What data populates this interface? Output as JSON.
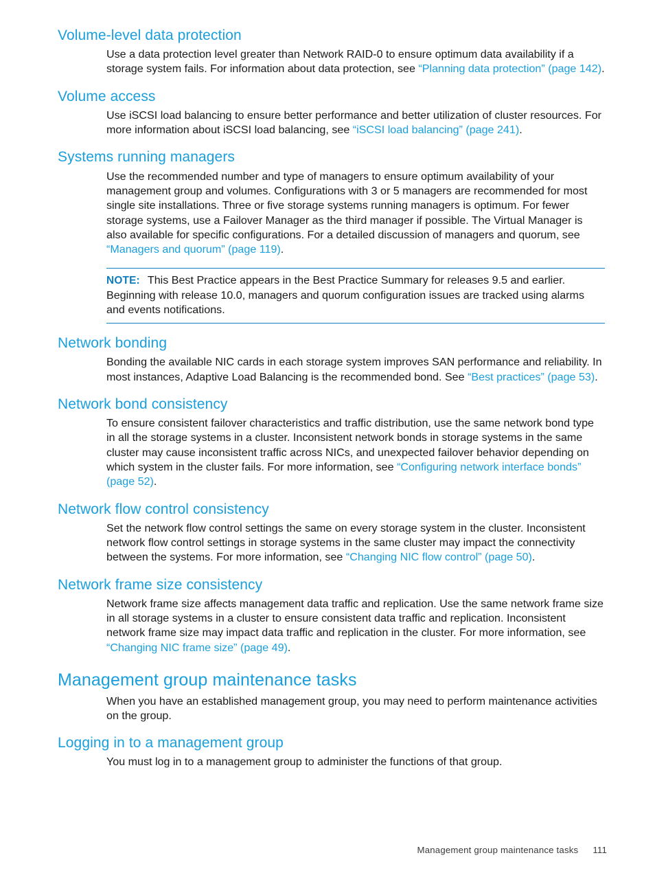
{
  "theme": {
    "heading_color": "#1a9fdc",
    "link_color": "#1a9fdc",
    "note_rule_color": "#0f80bd",
    "body_color": "#1a1a1a",
    "page_background": "#ffffff"
  },
  "sections": [
    {
      "id": "volume-level-data-protection",
      "level": "h2",
      "heading": "Volume-level data protection",
      "paragraphs": [
        {
          "runs": [
            {
              "type": "text",
              "text": "Use a data protection level greater than Network RAID-0 to ensure optimum data availability if a storage system fails. For information about data protection, see "
            },
            {
              "type": "link",
              "text": "“Planning data protection” (page 142)"
            },
            {
              "type": "text",
              "text": "."
            }
          ]
        }
      ]
    },
    {
      "id": "volume-access",
      "level": "h2",
      "heading": "Volume access",
      "paragraphs": [
        {
          "runs": [
            {
              "type": "text",
              "text": "Use iSCSI load balancing to ensure better performance and better utilization of cluster resources. For more information about iSCSI load balancing, see "
            },
            {
              "type": "link",
              "text": "“iSCSI load balancing” (page 241)"
            },
            {
              "type": "text",
              "text": "."
            }
          ]
        }
      ]
    },
    {
      "id": "systems-running-managers",
      "level": "h2",
      "heading": "Systems running managers",
      "paragraphs": [
        {
          "runs": [
            {
              "type": "text",
              "text": "Use the recommended number and type of managers to ensure optimum availability of your management group and volumes. Configurations with 3 or 5 managers are recommended for most single site installations. Three or five storage systems running managers is optimum. For fewer storage systems, use a Failover Manager as the third manager if possible. The Virtual Manager is also available for specific configurations. For a detailed discussion of managers and quorum, see "
            },
            {
              "type": "link",
              "text": "“Managers and quorum” (page 119)"
            },
            {
              "type": "text",
              "text": "."
            }
          ]
        }
      ],
      "note": {
        "label": "NOTE:",
        "text": "This Best Practice appears in the Best Practice Summary for releases 9.5 and earlier. Beginning with release 10.0, managers and quorum configuration issues are tracked using alarms and events notifications."
      }
    },
    {
      "id": "network-bonding",
      "level": "h2",
      "heading": "Network bonding",
      "paragraphs": [
        {
          "runs": [
            {
              "type": "text",
              "text": "Bonding the available NIC cards in each storage system improves SAN performance and reliability. In most instances, Adaptive Load Balancing is the recommended bond. See "
            },
            {
              "type": "link",
              "text": "“Best practices” (page 53)"
            },
            {
              "type": "text",
              "text": "."
            }
          ]
        }
      ]
    },
    {
      "id": "network-bond-consistency",
      "level": "h2",
      "heading": "Network bond consistency",
      "paragraphs": [
        {
          "runs": [
            {
              "type": "text",
              "text": "To ensure consistent failover characteristics and traffic distribution, use the same network bond type in all the storage systems in a cluster. Inconsistent network bonds in storage systems in the same cluster may cause inconsistent traffic across NICs, and unexpected failover behavior depending on which system in the cluster fails. For more information, see "
            },
            {
              "type": "link",
              "text": "“Configuring network interface bonds” (page 52)"
            },
            {
              "type": "text",
              "text": "."
            }
          ]
        }
      ]
    },
    {
      "id": "network-flow-control-consistency",
      "level": "h2",
      "heading": "Network flow control consistency",
      "paragraphs": [
        {
          "runs": [
            {
              "type": "text",
              "text": "Set the network flow control settings the same on every storage system in the cluster. Inconsistent network flow control settings in storage systems in the same cluster may impact the connectivity between the systems. For more information, see "
            },
            {
              "type": "link",
              "text": "“Changing NIC flow control” (page 50)"
            },
            {
              "type": "text",
              "text": "."
            }
          ]
        }
      ]
    },
    {
      "id": "network-frame-size-consistency",
      "level": "h2",
      "heading": "Network frame size consistency",
      "paragraphs": [
        {
          "runs": [
            {
              "type": "text",
              "text": "Network frame size affects management data traffic and replication. Use the same network frame size in all storage systems in a cluster to ensure consistent data traffic and replication. Inconsistent network frame size may impact data traffic and replication in the cluster. For more information, see "
            },
            {
              "type": "link",
              "text": "“Changing NIC frame size” (page 49)"
            },
            {
              "type": "text",
              "text": "."
            }
          ]
        }
      ]
    },
    {
      "id": "management-group-maintenance-tasks",
      "level": "h1",
      "heading": "Management group maintenance tasks",
      "paragraphs": [
        {
          "runs": [
            {
              "type": "text",
              "text": "When you have an established management group, you may need to perform maintenance activities on the group."
            }
          ]
        }
      ]
    },
    {
      "id": "logging-in-to-a-management-group",
      "level": "h2",
      "heading": "Logging in to a management group",
      "paragraphs": [
        {
          "runs": [
            {
              "type": "text",
              "text": "You must log in to a management group to administer the functions of that group."
            }
          ]
        }
      ]
    }
  ],
  "footer": {
    "title": "Management group maintenance tasks",
    "page_number": "111"
  }
}
